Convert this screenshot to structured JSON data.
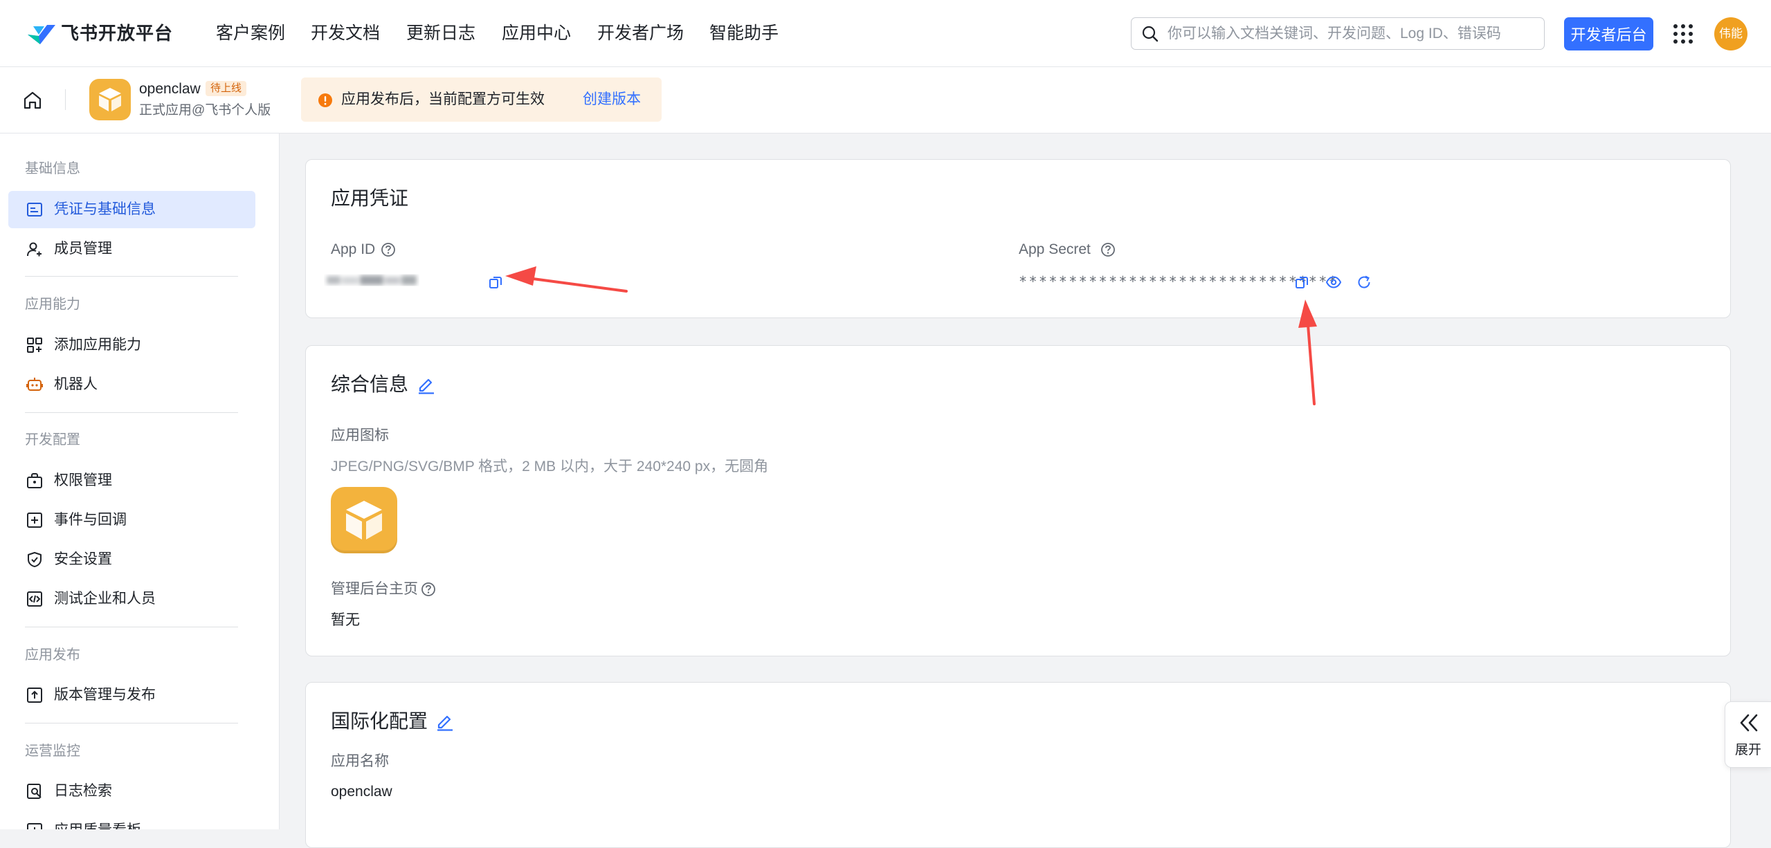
{
  "nav": {
    "brand": "飞书开放平台",
    "items": [
      "客户案例",
      "开发文档",
      "更新日志",
      "应用中心",
      "开发者广场",
      "智能助手"
    ],
    "search_placeholder": "你可以输入文档关键词、开发问题、Log ID、错误码",
    "dev_console": "开发者后台",
    "avatar_text": "伟能"
  },
  "app": {
    "name": "openclaw",
    "status": "待上线",
    "subtitle": "正式应用@飞书个人版",
    "notice": "应用发布后，当前配置方可生效",
    "notice_link": "创建版本"
  },
  "sidebar": {
    "groups": [
      {
        "title": "基础信息",
        "items": [
          {
            "label": "凭证与基础信息",
            "icon": "credential-icon",
            "active": true
          },
          {
            "label": "成员管理",
            "icon": "member-icon"
          }
        ]
      },
      {
        "title": "应用能力",
        "items": [
          {
            "label": "添加应用能力",
            "icon": "add-ability-icon"
          },
          {
            "label": "机器人",
            "icon": "robot-icon"
          }
        ]
      },
      {
        "title": "开发配置",
        "items": [
          {
            "label": "权限管理",
            "icon": "permission-icon"
          },
          {
            "label": "事件与回调",
            "icon": "event-icon"
          },
          {
            "label": "安全设置",
            "icon": "shield-icon"
          },
          {
            "label": "测试企业和人员",
            "icon": "code-icon"
          }
        ]
      },
      {
        "title": "应用发布",
        "items": [
          {
            "label": "版本管理与发布",
            "icon": "upload-icon"
          }
        ]
      },
      {
        "title": "运营监控",
        "items": [
          {
            "label": "日志检索",
            "icon": "log-search-icon"
          },
          {
            "label": "应用质量看板",
            "icon": "dashboard-icon"
          }
        ]
      }
    ]
  },
  "credentials": {
    "title": "应用凭证",
    "app_id_label": "App ID",
    "app_secret_label": "App Secret",
    "app_secret_value": "********************************"
  },
  "general": {
    "title": "综合信息",
    "icon_label": "应用图标",
    "icon_hint": "JPEG/PNG/SVG/BMP 格式，2 MB 以内，大于 240*240 px，无圆角",
    "admin_home_label": "管理后台主页",
    "admin_home_value": "暂无"
  },
  "i18n": {
    "title": "国际化配置",
    "name_label": "应用名称",
    "name_value": "openclaw"
  },
  "expand_label": "展开",
  "colors": {
    "accent": "#3370ff",
    "arrow": "#f54a45",
    "app_icon": "#f3b33d",
    "warning": "#f77a0d"
  }
}
